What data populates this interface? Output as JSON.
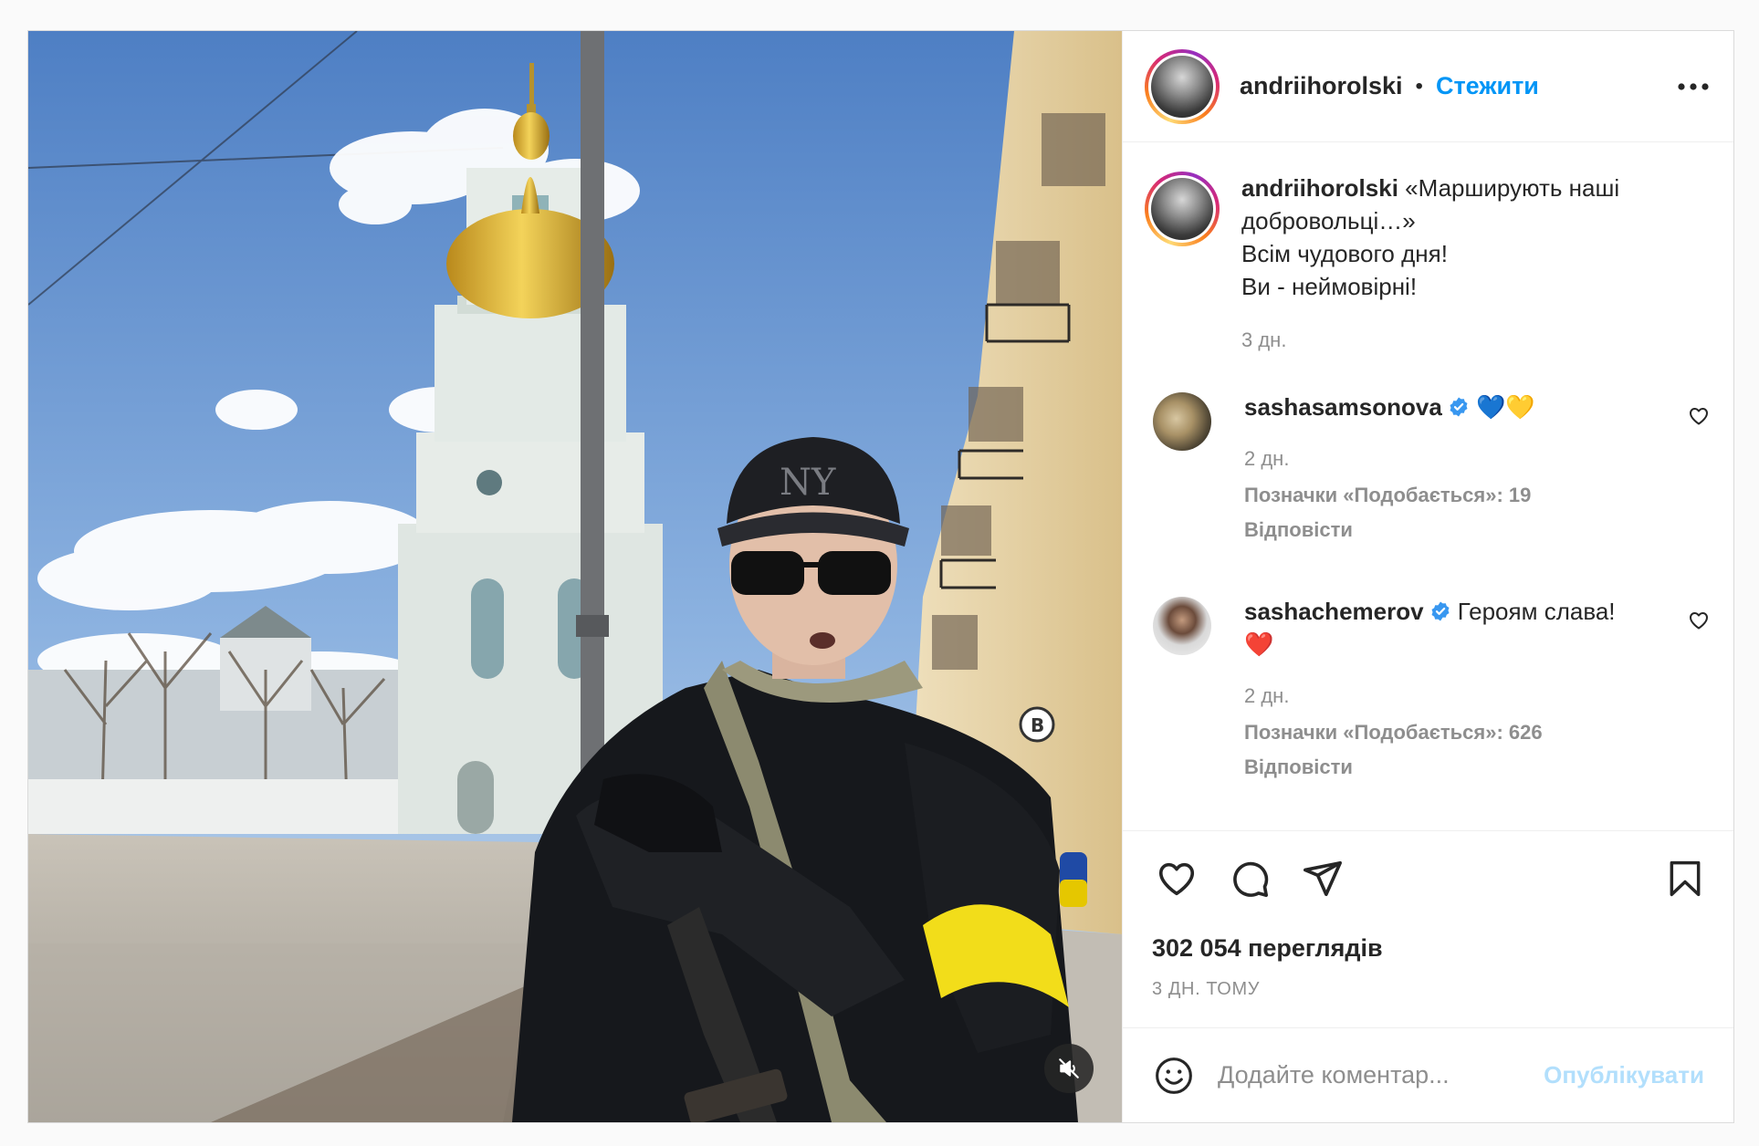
{
  "post": {
    "username": "andriihorolski",
    "dot": "•",
    "follow_label": "Стежити",
    "caption": {
      "username": "andriihorolski",
      "lines": [
        "«Марширують наші",
        "добровольці…»",
        "Всім чудового дня!",
        "Ви - неймовірні!"
      ],
      "time": "3 дн."
    },
    "comments": [
      {
        "username": "sashasamsonova",
        "verified": true,
        "text": "💙💛",
        "time": "2 дн.",
        "likes": "Позначки «Подобається»: 19",
        "reply_label": "Відповісти"
      },
      {
        "username": "sashachemerov",
        "verified": true,
        "text": "Героям слава!",
        "text2": "❤️",
        "time": "2 дн.",
        "likes": "Позначки «Подобається»: 626",
        "reply_label": "Відповісти"
      }
    ],
    "views": "302 054 переглядів",
    "time_ago": "3 ДН. ТОМУ",
    "comment_placeholder": "Додайте коментар...",
    "publish_label": "Опублікувати"
  },
  "colors": {
    "link_blue": "#0095f6",
    "publish_disabled": "#b2dffc",
    "muted_text": "#8e8e8e",
    "armband_yellow": "#f2dd1a"
  },
  "icons": {
    "more": "more-horizontal-icon",
    "like": "heart-icon",
    "comment": "comment-bubble-icon",
    "share": "paper-plane-icon",
    "save": "bookmark-icon",
    "emoji": "smiley-icon",
    "mute": "speaker-muted-icon",
    "verified": "verified-badge-icon"
  }
}
